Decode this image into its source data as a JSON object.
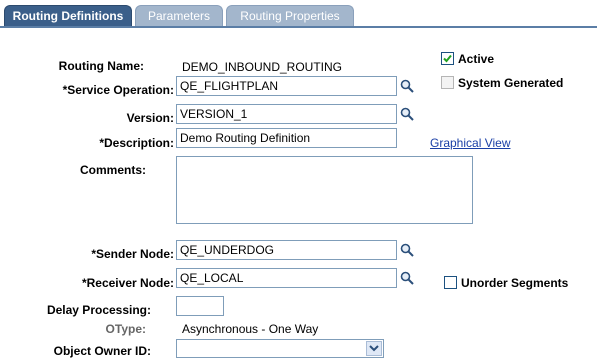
{
  "tabs": [
    {
      "label": "Routing Definitions",
      "active": true
    },
    {
      "label": "Parameters",
      "active": false
    },
    {
      "label": "Routing Properties",
      "active": false
    }
  ],
  "form": {
    "routing_name_label": "Routing Name:",
    "routing_name_value": "DEMO_INBOUND_ROUTING",
    "service_operation_label": "*Service Operation:",
    "service_operation_value": "QE_FLIGHTPLAN",
    "version_label": "Version:",
    "version_value": "VERSION_1",
    "description_label": "*Description:",
    "description_value": "Demo Routing Definition",
    "comments_label": "Comments:",
    "comments_value": "",
    "sender_node_label": "*Sender Node:",
    "sender_node_value": "QE_UNDERDOG",
    "receiver_node_label": "*Receiver Node:",
    "receiver_node_value": "QE_LOCAL",
    "delay_processing_label": "Delay Processing:",
    "delay_processing_value": "",
    "otype_label": "OType:",
    "otype_value": "Asynchronous - One Way",
    "object_owner_label": "Object Owner ID:",
    "object_owner_value": ""
  },
  "checkboxes": {
    "active_label": "Active",
    "active_checked": true,
    "system_generated_label": "System Generated",
    "system_generated_checked": false,
    "unorder_segments_label": "Unorder Segments",
    "unorder_segments_checked": false
  },
  "links": {
    "graphical_view": "Graphical View"
  },
  "icons": {
    "lookup": "magnifier-icon",
    "dropdown": "chevron-down-icon",
    "checkmark": "check-icon"
  },
  "colors": {
    "tab_active": "#3b5f8a",
    "tab_inactive": "#a3b6cc",
    "link": "#1a3fa6",
    "check": "#21a121"
  }
}
